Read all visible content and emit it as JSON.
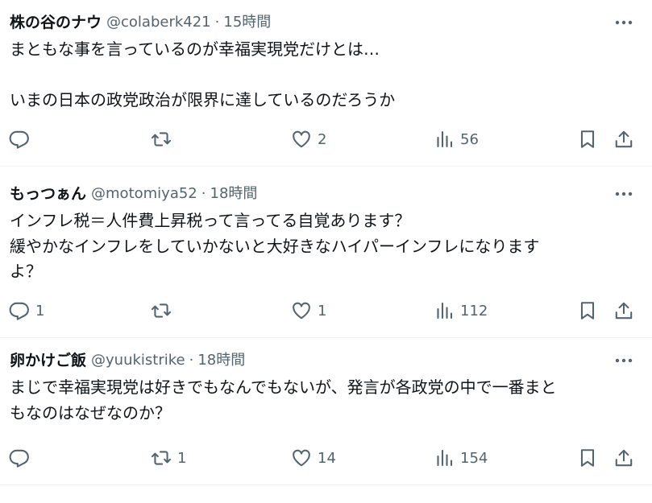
{
  "tweets": [
    {
      "name": "株の谷のナウ",
      "handle": "@colaberk421",
      "separator": "·",
      "time": "15時間",
      "lines": [
        "まともな事を言っているのが幸福実現党だけとは…",
        "",
        "いまの日本の政党政治が限界に達しているのだろうか"
      ],
      "replies": "",
      "reposts": "",
      "likes": "2",
      "views": "56"
    },
    {
      "name": "もっつぁん",
      "handle": "@motomiya52",
      "separator": "·",
      "time": "18時間",
      "lines": [
        "インフレ税＝人件費上昇税って言ってる自覚あります？",
        "緩やかなインフレをしていかないと大好きなハイパーインフレになります",
        "よ？"
      ],
      "replies": "1",
      "reposts": "",
      "likes": "1",
      "views": "112"
    },
    {
      "name": "卵かけご飯",
      "handle": "@yuukistrike",
      "separator": "·",
      "time": "18時間",
      "lines": [
        "まじで幸福実現党は好きでもなんでもないが、発言が各政党の中で一番まと",
        "もなのはなぜなのか？"
      ],
      "replies": "",
      "reposts": "1",
      "likes": "14",
      "views": "154"
    }
  ],
  "icons": {
    "reply": "reply-icon",
    "repost": "repost-icon",
    "like": "like-icon",
    "views": "views-icon",
    "bookmark": "bookmark-icon",
    "share": "share-icon",
    "more": "more-icon"
  },
  "colors": {
    "text": "#0f1419",
    "secondary": "#536471",
    "divider": "#eff3f4"
  }
}
